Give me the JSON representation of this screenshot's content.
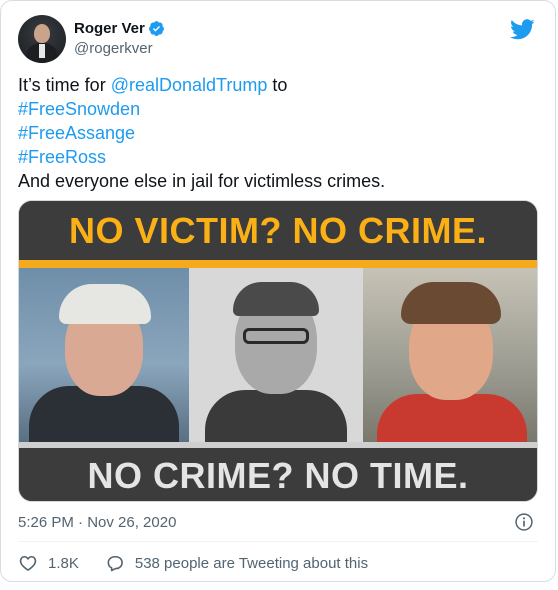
{
  "author": {
    "display_name": "Roger Ver",
    "handle": "@rogerkver",
    "verified": true
  },
  "tweet": {
    "line1_prefix": "It’s time for ",
    "mention": "@realDonaldTrump",
    "line1_suffix": " to",
    "hashtags": [
      "#FreeSnowden",
      "#FreeAssange",
      "#FreeRoss"
    ],
    "closing_line": "And everyone else in jail for victimless crimes."
  },
  "media": {
    "headline_top": "NO VICTIM? NO CRIME.",
    "headline_bottom": "NO CRIME? NO TIME."
  },
  "meta": {
    "timestamp": "5:26 PM · Nov 26, 2020"
  },
  "actions": {
    "like_count": "1.8K",
    "conversation_text": "538 people are Tweeting about this"
  },
  "colors": {
    "link": "#1d9bf0",
    "banner_yellow": "#fbb116",
    "banner_dark": "#3c3c3c"
  }
}
